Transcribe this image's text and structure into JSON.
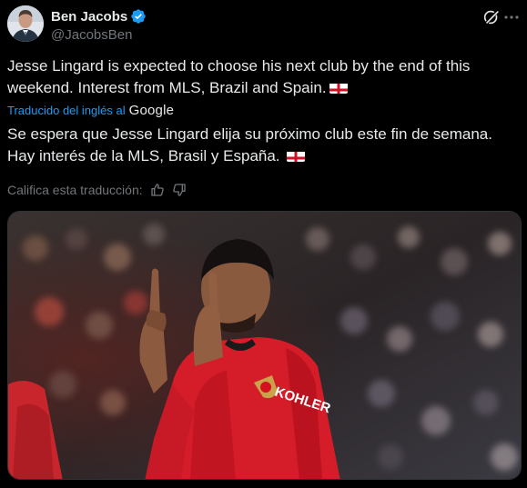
{
  "author": {
    "display_name": "Ben Jacobs",
    "handle": "@JacobsBen",
    "verified": true
  },
  "header_icons": {
    "grok": "grok-icon",
    "more": "more-icon"
  },
  "tweet": {
    "original_text": "Jesse Lingard is expected to choose his next club by the end of this weekend. Interest from MLS, Brazil and Spain.",
    "translated_by_label": "Traducido del inglés al",
    "translator": "Google",
    "translated_text": "Se espera que Jesse Lingard elija su próximo club este fin de semana. Hay interés de la MLS, Brasil y España.",
    "flag_emoji": "england-flag"
  },
  "rating": {
    "label": "Califica esta traducción:",
    "up_icon": "thumbs-up-icon",
    "down_icon": "thumbs-down-icon"
  },
  "media": {
    "kit_sponsor": "KOHLER"
  },
  "colors": {
    "background": "#000000",
    "text": "#e7e9ea",
    "muted": "#71767b",
    "link": "#1d9bf0",
    "verified": "#1d9bf0",
    "kit_red": "#d51d2a"
  }
}
